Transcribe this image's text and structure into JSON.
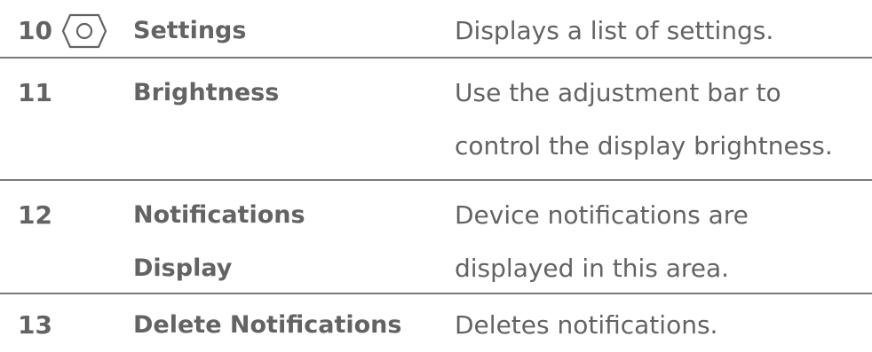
{
  "rows": [
    {
      "number": "10",
      "icon": "settings-hexagon-icon",
      "name": "Settings",
      "description_lines": [
        "Displays a list of settings."
      ]
    },
    {
      "number": "11",
      "name": "Brightness",
      "description_lines": [
        "Use the adjustment bar to",
        "control the display brightness."
      ]
    },
    {
      "number": "12",
      "name_lines": [
        "Notifications",
        "Display"
      ],
      "description_lines": [
        "Device notifications are",
        "displayed in this area."
      ]
    },
    {
      "number": "13",
      "name": "Delete Notifications",
      "description_lines": [
        "Deletes notifications."
      ]
    }
  ],
  "colors": {
    "text": "#636363",
    "divider": "#7a7a7a",
    "background": "#ffffff"
  }
}
